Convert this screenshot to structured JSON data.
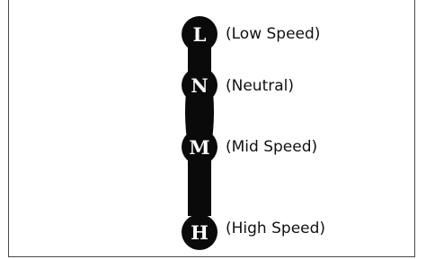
{
  "gear_positions": [
    {
      "letter": "L",
      "label": "(Low Speed)"
    },
    {
      "letter": "N",
      "label": "(Neutral)"
    },
    {
      "letter": "M",
      "label": "(Mid Speed)"
    },
    {
      "letter": "H",
      "label": "(High Speed)"
    }
  ],
  "colors": {
    "knob": "#0a0a0a",
    "letter": "#ffffff",
    "label": "#111111",
    "border": "#4a4a4a"
  }
}
